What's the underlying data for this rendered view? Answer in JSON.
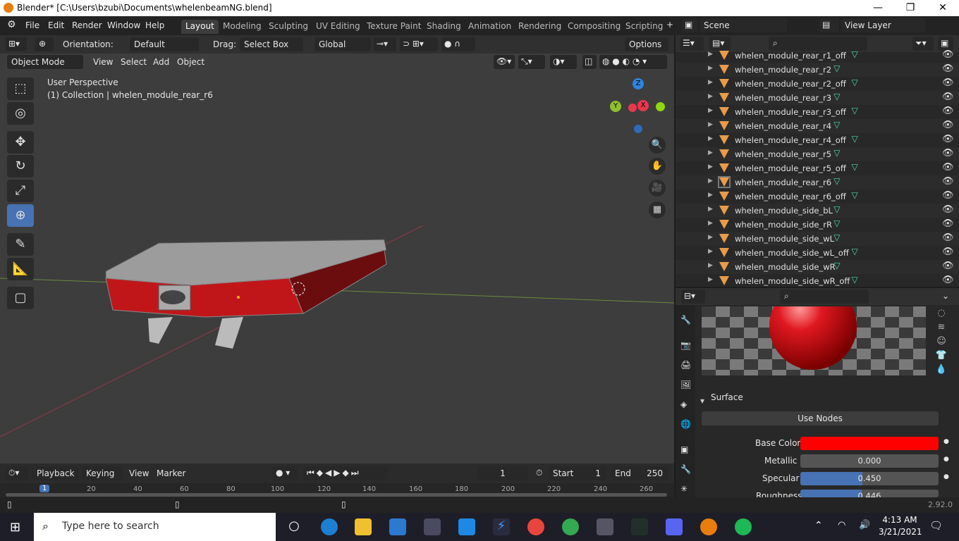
{
  "window": {
    "title": "Blender* [C:\\Users\\bzubi\\Documents\\whelenbeamNG.blend]"
  },
  "menus": [
    "File",
    "Edit",
    "Render",
    "Window",
    "Help"
  ],
  "workspaces": [
    "Layout",
    "Modeling",
    "Sculpting",
    "UV Editing",
    "Texture Paint",
    "Shading",
    "Animation",
    "Rendering",
    "Compositing",
    "Scripting"
  ],
  "scene": {
    "name": "Scene",
    "view_layer": "View Layer"
  },
  "header": {
    "orientation_label": "Orientation:",
    "orientation_value": "Default",
    "drag_label": "Drag:",
    "drag_value": "Select Box",
    "transform_value": "Global",
    "options": "Options"
  },
  "header2": {
    "mode": "Object Mode",
    "view": "View",
    "select": "Select",
    "add": "Add",
    "object": "Object"
  },
  "viewport": {
    "perspective": "User Perspective",
    "collection": "(1) Collection | whelen_module_rear_r6",
    "axes": {
      "z": "Z",
      "y": "Y",
      "x": "X"
    }
  },
  "outliner": {
    "items": [
      "whelen_module_rear_r1_off",
      "whelen_module_rear_r2",
      "whelen_module_rear_r2_off",
      "whelen_module_rear_r3",
      "whelen_module_rear_r3_off",
      "whelen_module_rear_r4",
      "whelen_module_rear_r4_off",
      "whelen_module_rear_r5",
      "whelen_module_rear_r5_off",
      "whelen_module_rear_r6",
      "whelen_module_rear_r6_off",
      "whelen_module_side_bL",
      "whelen_module_side_rR",
      "whelen_module_side_wL",
      "whelen_module_side_wL_off",
      "whelen_module_side_wR",
      "whelen_module_side_wR_off"
    ],
    "selected": "whelen_module_rear_r6"
  },
  "properties": {
    "surface": "Surface",
    "use_nodes": "Use Nodes",
    "base_color_label": "Base Color",
    "base_color": "#ff0000",
    "metallic_label": "Metallic",
    "metallic": "0.000",
    "specular_label": "Specular",
    "specular": "0.450",
    "specular_fraction": 0.45,
    "roughness_label": "Roughness",
    "roughness": "0.446",
    "roughness_fraction": 0.446
  },
  "timeline": {
    "playback": "Playback",
    "keying": "Keying",
    "view": "View",
    "marker": "Marker",
    "current_frame": "1",
    "start_label": "Start",
    "start": "1",
    "end_label": "End",
    "end": "250",
    "ticks": [
      "1",
      "20",
      "40",
      "60",
      "80",
      "100",
      "120",
      "140",
      "160",
      "180",
      "200",
      "220",
      "240",
      "260"
    ]
  },
  "status": {
    "version": "2.92.0"
  },
  "taskbar": {
    "search_placeholder": "Type here to search",
    "time": "4:13 AM",
    "date": "3/21/2021"
  }
}
